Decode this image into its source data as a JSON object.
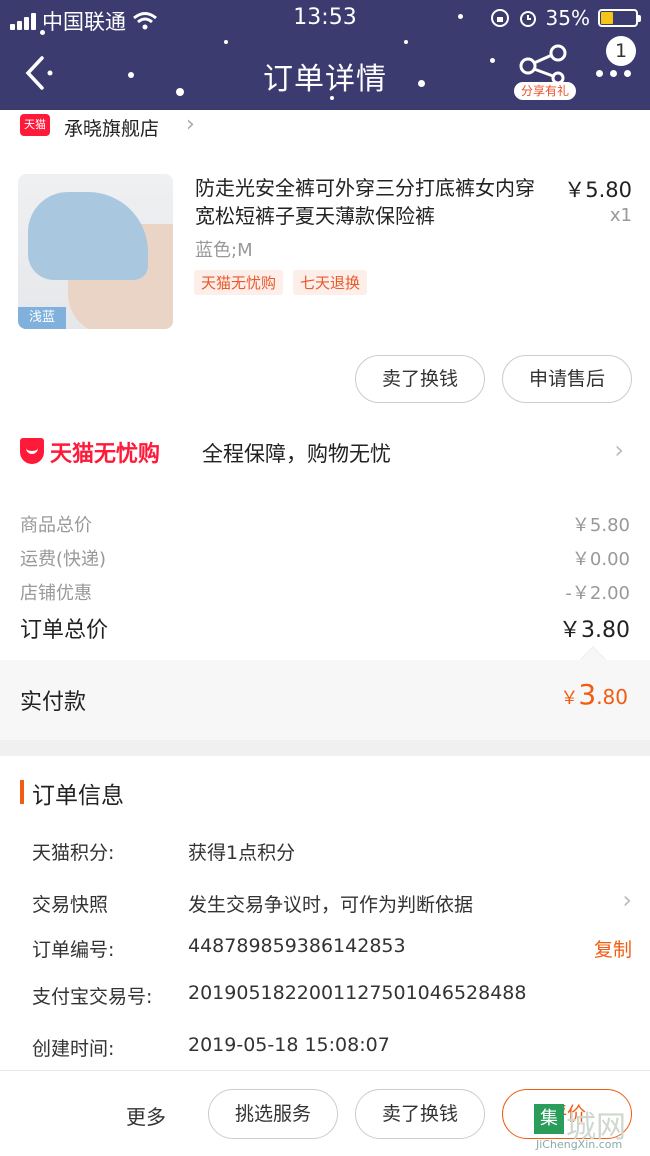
{
  "status_bar": {
    "carrier": "中国联通",
    "time": "13:53",
    "battery_pct": "35%",
    "battery_level": 0.35
  },
  "nav": {
    "title": "订单详情",
    "share_label": "分享有礼",
    "badge_count": "1"
  },
  "store": {
    "logo_text": "天猫",
    "name": "承晓旗舰店"
  },
  "product": {
    "title": "防走光安全裤可外穿三分打底裤女内穿宽松短裤子夏天薄款保险裤",
    "price": "￥5.80",
    "qty": "x1",
    "spec": "蓝色;M",
    "image_tag": "浅蓝",
    "tags": [
      "天猫无忧购",
      "七天退换"
    ]
  },
  "item_actions": {
    "sell": "卖了换钱",
    "after_sale": "申请售后"
  },
  "guarantee": {
    "brand": "天猫无忧购",
    "text": "全程保障，购物无忧"
  },
  "costs": {
    "subtotal_label": "商品总价",
    "subtotal_value": "￥5.80",
    "shipping_label": "运费(快递)",
    "shipping_value": "￥0.00",
    "discount_label": "店铺优惠",
    "discount_value": "-￥2.00",
    "total_label": "订单总价",
    "total_value": "￥3.80",
    "paid_label": "实付款",
    "paid_currency": "￥",
    "paid_int": "3",
    "paid_dec": ".80"
  },
  "order_info": {
    "title": "订单信息",
    "points_label": "天猫积分:",
    "points_value": "获得1点积分",
    "snapshot_label": "交易快照",
    "snapshot_value": "发生交易争议时，可作为判断依据",
    "order_no_label": "订单编号:",
    "order_no_value": "448789859386142853",
    "copy_label": "复制",
    "alipay_label": "支付宝交易号:",
    "alipay_value": "2019051822001127501046528488",
    "created_label": "创建时间:",
    "created_value": "2019-05-18 15:08:07"
  },
  "bottom_bar": {
    "more": "更多",
    "select_service": "挑选服务",
    "sell": "卖了换钱",
    "review": "评价"
  },
  "watermark": {
    "char": "集",
    "text": "城网",
    "url": "JiChengXin.com"
  },
  "colors": {
    "header_bg": "#3c3b70",
    "accent_orange": "#f25c12",
    "tmall_red": "#ff1a3a"
  }
}
